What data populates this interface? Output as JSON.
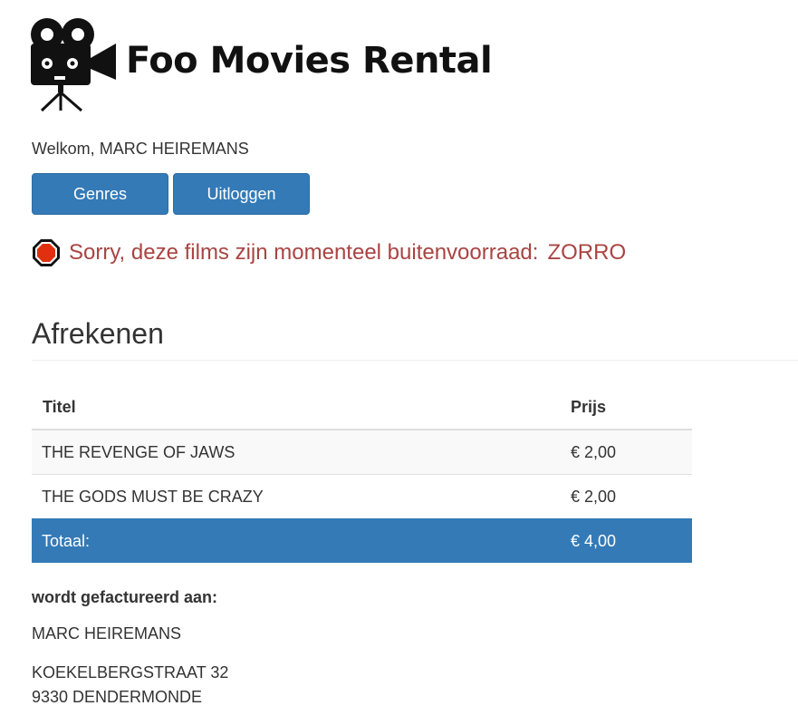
{
  "app": {
    "title": "Foo Movies Rental",
    "logo_icon": "movie-camera-icon"
  },
  "header": {
    "welcome_prefix": "Welkom,",
    "user_name": "MARC HEIREMANS"
  },
  "nav": {
    "genres_label": "Genres",
    "logout_label": "Uitloggen"
  },
  "alert": {
    "icon": "stop-icon",
    "message": "Sorry, deze films zijn momenteel buitenvoorraad:",
    "films": "ZORRO",
    "color": "#a94442"
  },
  "checkout": {
    "title": "Afrekenen",
    "columns": [
      "Titel",
      "Prijs"
    ],
    "rows": [
      {
        "title": "THE REVENGE OF JAWS",
        "price": "€ 2,00"
      },
      {
        "title": "THE GODS MUST BE CRAZY",
        "price": "€ 2,00"
      }
    ],
    "total_label": "Totaal:",
    "total_value": "€ 4,00",
    "accent_color": "#337ab7"
  },
  "billing": {
    "label": "wordt gefactureerd aan:",
    "name": "MARC HEIREMANS",
    "street": "KOEKELBERGSTRAAT 32",
    "city": "9330 DENDERMONDE"
  }
}
